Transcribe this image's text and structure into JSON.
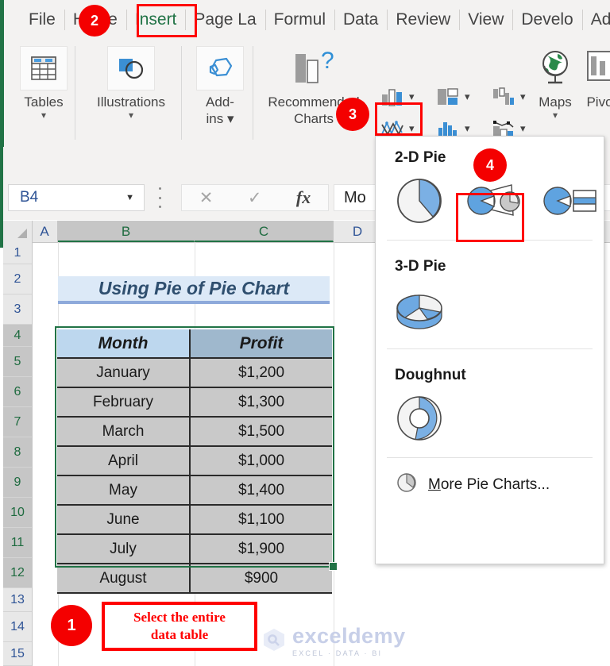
{
  "app": {
    "accent_green": "#217346",
    "callout_red": "#ff0000"
  },
  "ribbon": {
    "tabs": [
      {
        "label": "File",
        "active": false
      },
      {
        "label": "Home",
        "active": false
      },
      {
        "label": "Insert",
        "active": true
      },
      {
        "label": "Page La",
        "active": false
      },
      {
        "label": "Formul",
        "active": false
      },
      {
        "label": "Data",
        "active": false
      },
      {
        "label": "Review",
        "active": false
      },
      {
        "label": "View",
        "active": false
      },
      {
        "label": "Develo",
        "active": false
      },
      {
        "label": "Add-i",
        "active": false
      }
    ],
    "groups": [
      {
        "label": "Tables",
        "icon": "table-icon",
        "has_chevron": true
      },
      {
        "label": "Illustrations",
        "icon": "illustrations-icon",
        "has_chevron": true
      },
      {
        "label": "Add-ins",
        "icon": "addins-icon",
        "has_chevron": true
      },
      {
        "label": "Recommended Charts",
        "icon": "recommended-charts-icon",
        "has_chevron": false
      },
      {
        "label": "Maps",
        "icon": "maps-globe-icon",
        "has_chevron": true
      },
      {
        "label": "Pivo",
        "icon": "pivot-chart-icon",
        "has_chevron": false
      }
    ],
    "chart_buttons": [
      {
        "name": "column-bar-chart-icon"
      },
      {
        "name": "hierarchy-chart-icon"
      },
      {
        "name": "waterfall-chart-icon"
      },
      {
        "name": "line-area-chart-icon"
      },
      {
        "name": "statistic-chart-icon"
      },
      {
        "name": "combo-chart-icon"
      },
      {
        "name": "pie-doughnut-chart-icon"
      },
      {
        "name": "scatter-bubble-chart-icon"
      }
    ]
  },
  "gallery": {
    "sections": [
      {
        "heading": "2-D Pie",
        "items": [
          {
            "name": "pie-chart-option"
          },
          {
            "name": "pie-of-pie-chart-option"
          },
          {
            "name": "bar-of-pie-chart-option"
          }
        ]
      },
      {
        "heading": "3-D Pie",
        "items": [
          {
            "name": "pie-3d-chart-option"
          }
        ]
      },
      {
        "heading": "Doughnut",
        "items": [
          {
            "name": "doughnut-chart-option"
          }
        ]
      }
    ],
    "more_label_first": "M",
    "more_label_rest": "ore Pie Charts..."
  },
  "formula_bar": {
    "name_box_value": "B4",
    "cancel_icon": "✕",
    "enter_icon": "✓",
    "function_icon": "fx",
    "content": "Mo"
  },
  "sheet": {
    "columns": [
      {
        "label": "A",
        "selected": false
      },
      {
        "label": "B",
        "selected": true
      },
      {
        "label": "C",
        "selected": true
      },
      {
        "label": "D",
        "selected": false
      }
    ],
    "rows": [
      "1",
      "2",
      "3",
      "4",
      "5",
      "6",
      "7",
      "8",
      "9",
      "10",
      "11",
      "12",
      "13",
      "14",
      "15"
    ],
    "selected_rows": [
      "4",
      "5",
      "6",
      "7",
      "8",
      "9",
      "10",
      "11",
      "12"
    ],
    "title_cell": "Using Pie of Pie Chart",
    "table": {
      "headers": [
        "Month",
        "Profit"
      ],
      "rows": [
        [
          "January",
          "$1,200"
        ],
        [
          "February",
          "$1,300"
        ],
        [
          "March",
          "$1,500"
        ],
        [
          "April",
          "$1,000"
        ],
        [
          "May",
          "$1,400"
        ],
        [
          "June",
          "$1,100"
        ],
        [
          "July",
          "$1,900"
        ],
        [
          "August",
          "$900"
        ]
      ]
    }
  },
  "annotations": {
    "badges": [
      {
        "number": "1"
      },
      {
        "number": "2"
      },
      {
        "number": "3"
      },
      {
        "number": "4"
      }
    ],
    "note_line1": "Select the entire",
    "note_line2": "data table"
  },
  "watermark": {
    "name": "exceldemy",
    "tagline": "EXCEL · DATA · BI"
  },
  "chart_data": {
    "type": "table",
    "title": "Using Pie of Pie Chart",
    "categories": [
      "January",
      "February",
      "March",
      "April",
      "May",
      "June",
      "July",
      "August"
    ],
    "values": [
      1200,
      1300,
      1500,
      1000,
      1400,
      1100,
      1900,
      900
    ],
    "xlabel": "Month",
    "ylabel": "Profit",
    "unit": "USD"
  }
}
